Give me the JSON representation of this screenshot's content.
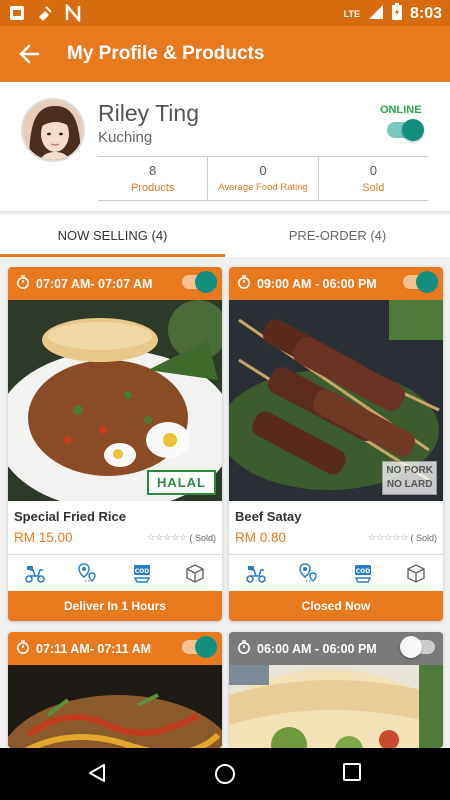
{
  "status_bar": {
    "time": "8:03",
    "network": "LTE"
  },
  "app_bar": {
    "title": "My Profile & Products"
  },
  "profile": {
    "name": "Riley Ting",
    "location": "Kuching",
    "status": "ONLINE",
    "online": true,
    "stats": [
      {
        "value": "8",
        "label": "Products"
      },
      {
        "value": "0",
        "label": "Average Food Rating"
      },
      {
        "value": "0",
        "label": "Sold"
      }
    ]
  },
  "tabs": [
    {
      "label": "NOW SELLING (4)",
      "active": true
    },
    {
      "label": "PRE-ORDER (4)",
      "active": false
    }
  ],
  "products": [
    {
      "time": "07:07 AM- 07:07 AM",
      "enabled": true,
      "name": "Special Fried Rice",
      "price": "RM 15.00",
      "sold": "( Sold)",
      "badge": "HALAL",
      "footer": "Deliver In 1 Hours"
    },
    {
      "time": "09:00 AM - 06:00 PM",
      "enabled": true,
      "name": "Beef Satay",
      "price": "RM 0.80",
      "sold": "( Sold)",
      "badge_line1": "NO PORK",
      "badge_line2": "NO LARD",
      "footer": "Closed Now"
    },
    {
      "time": "07:11 AM- 07:11 AM",
      "enabled": true
    },
    {
      "time": "06:00 AM - 06:00 PM",
      "enabled": false
    }
  ],
  "colors": {
    "primary": "#e8791f",
    "accent": "#138f80",
    "online": "#2aa84a"
  }
}
